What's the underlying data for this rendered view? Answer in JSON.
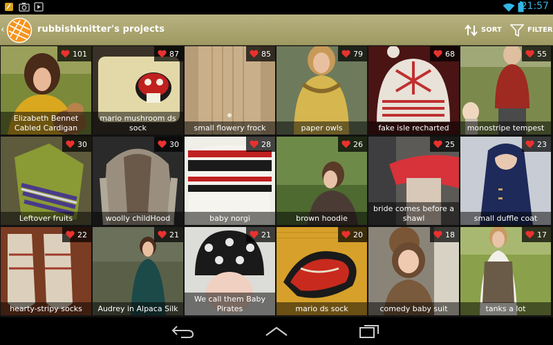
{
  "status": {
    "time": "21:57"
  },
  "header": {
    "title": "rubbishknitter's projects",
    "sort_label": "SORT",
    "filter_label": "FILTER"
  },
  "colors": {
    "accent": "#33b5e5",
    "action_bar": "#a9a26c",
    "heart": "#e8322f",
    "logo_orange": "#f7941d"
  },
  "projects": [
    {
      "name": "Elizabeth Bennet Cabled Cardigan",
      "likes": "101"
    },
    {
      "name": "mario mushroom ds sock",
      "likes": "87"
    },
    {
      "name": "small flowery frock",
      "likes": "85"
    },
    {
      "name": "paper owls",
      "likes": "79"
    },
    {
      "name": "fake isle recharted",
      "likes": "68"
    },
    {
      "name": "monostripe tempest",
      "likes": "55"
    },
    {
      "name": "Leftover fruits",
      "likes": "30"
    },
    {
      "name": "woolly childHood",
      "likes": "30"
    },
    {
      "name": "baby norgi",
      "likes": "28"
    },
    {
      "name": "brown hoodie",
      "likes": "26"
    },
    {
      "name": "bride comes before a shawl",
      "likes": "25"
    },
    {
      "name": "small duffle coat",
      "likes": "23"
    },
    {
      "name": "hearty-stripy socks",
      "likes": "22"
    },
    {
      "name": "Audrey in Alpaca Silk",
      "likes": "21"
    },
    {
      "name": "We call them Baby Pirates",
      "likes": "21"
    },
    {
      "name": "mario ds sock",
      "likes": "20"
    },
    {
      "name": "comedy baby suit",
      "likes": "18"
    },
    {
      "name": "tanks a lot",
      "likes": "17"
    }
  ]
}
